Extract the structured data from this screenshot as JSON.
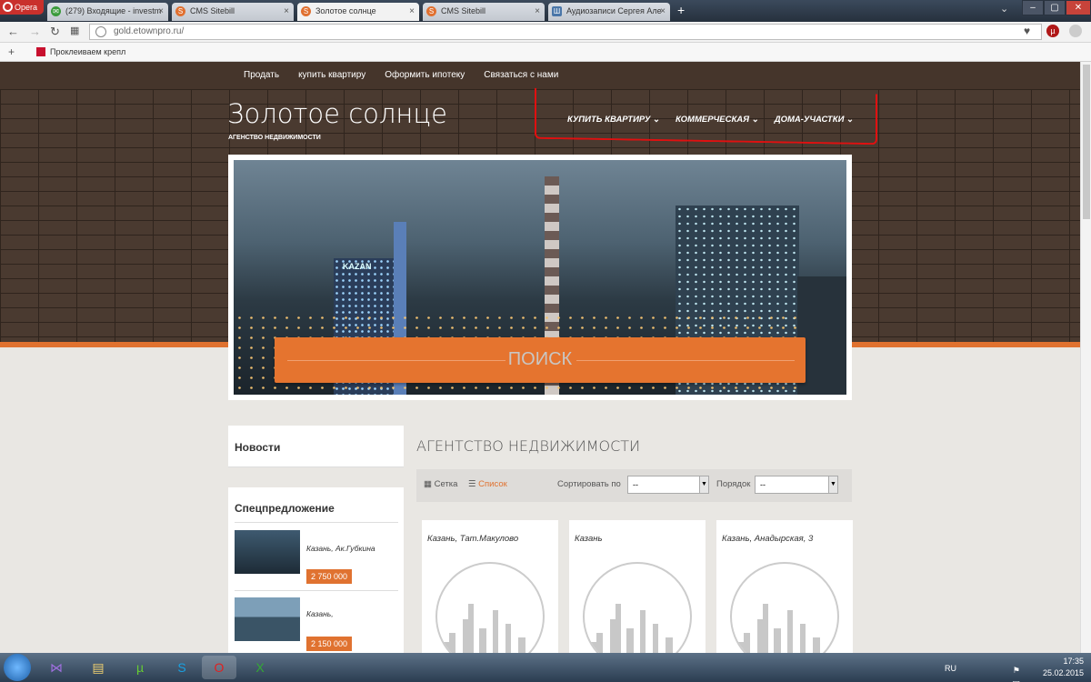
{
  "browser": {
    "opera_label": "Opera",
    "tabs": [
      {
        "title": "(279) Входящие - investm",
        "icon": "mail-icon"
      },
      {
        "title": "CMS Sitebill",
        "icon": "sitebill-icon"
      },
      {
        "title": "Золотое солнце",
        "icon": "sitebill-icon",
        "active": true
      },
      {
        "title": "CMS Sitebill",
        "icon": "sitebill-icon"
      },
      {
        "title": "Аудиозаписи Сергея Але",
        "icon": "vk-icon"
      }
    ],
    "url": "gold.etownpro.ru/",
    "bookmark": "Проклеиваем крепл"
  },
  "site": {
    "top_nav": [
      "Продать",
      "купить квартиру",
      "Оформить ипотеку",
      "Связаться с нами"
    ],
    "title": "Золотое солнце",
    "subtitle": "АГЕНСТВО НЕДВИЖИМОСТИ",
    "main_menu": [
      "КУПИТЬ КВАРТИРУ",
      "КОММЕРЧЕСКАЯ",
      "ДОМА-УЧАСТКИ"
    ],
    "search_label": "ПОИСК",
    "hero_sign": "KAZAN"
  },
  "sidebar": {
    "news_title": "Новости",
    "special_title": "Спецпредложение",
    "special_items": [
      {
        "location": "Казань, Ак.Губкина",
        "price": "2 750 000"
      },
      {
        "location": "Казань,",
        "price": "2 150 000"
      }
    ]
  },
  "content": {
    "title": "АГЕНТСТВО НЕДВИЖИМОСТИ",
    "view_grid": "Сетка",
    "view_list": "Список",
    "sort_label": "Сортировать по",
    "sort_value": "--",
    "order_label": "Порядок",
    "order_value": "--",
    "listings": [
      {
        "location": "Казань, Тат.Макулово"
      },
      {
        "location": "Казань"
      },
      {
        "location": "Казань, Анадырская, 3"
      }
    ]
  },
  "taskbar": {
    "lang": "RU",
    "time": "17:35",
    "date": "25.02.2015"
  },
  "colors": {
    "accent": "#e07230",
    "nav_bg": "#45352b",
    "annotation": "#e01010"
  }
}
